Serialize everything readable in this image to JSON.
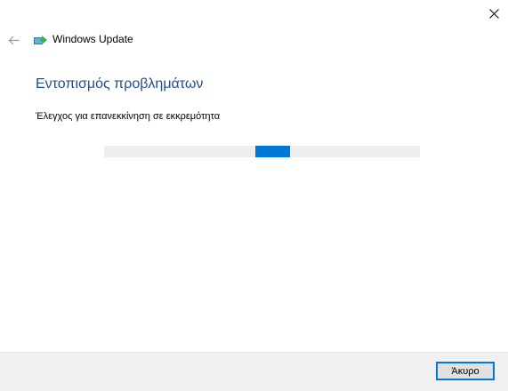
{
  "window": {
    "app_title": "Windows Update",
    "close_icon": "close-icon",
    "back_icon": "back-arrow-icon",
    "app_icon": "windows-update-icon"
  },
  "content": {
    "heading": "Εντοπισμός προβλημάτων",
    "status": "Έλεγχος για επανεκκίνηση σε εκκρεμότητα"
  },
  "progress": {
    "mode": "indeterminate",
    "chunk_start_fraction": 0.48,
    "chunk_length_fraction": 0.11
  },
  "footer": {
    "cancel_label": "Άκυρο"
  },
  "colors": {
    "heading": "#1e4e8c",
    "accent": "#0078d7",
    "track": "#eeeeee",
    "footer_bg": "#f0f0f0"
  }
}
